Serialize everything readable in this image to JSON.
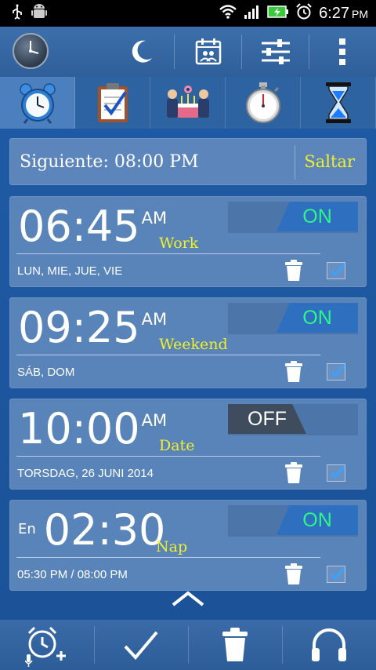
{
  "status_bar": {
    "time": "6:27",
    "ampm": "PM"
  },
  "icons": {
    "night_mode": "moon-icon",
    "calendar": "calendar-icon",
    "settings": "sliders-icon",
    "menu": "overflow-menu-icon"
  },
  "tabs": [
    {
      "name": "alarm-clock-icon",
      "active": true
    },
    {
      "name": "clipboard-icon",
      "active": false
    },
    {
      "name": "birthday-cake-icon",
      "active": false
    },
    {
      "name": "stopwatch-icon",
      "active": false
    },
    {
      "name": "hourglass-icon",
      "active": false
    }
  ],
  "next_alarm": {
    "label": "Siguiente:  08:00 PM",
    "skip_label": "Saltar"
  },
  "alarms": [
    {
      "prefix": "",
      "time": "06:45",
      "ampm": "AM",
      "label": "Work",
      "days": "LUN, MIE, JUE, VIE",
      "toggle": "ON",
      "enabled": true,
      "checked": true
    },
    {
      "prefix": "",
      "time": "09:25",
      "ampm": "AM",
      "label": "Weekend",
      "days": "SÁB, DOM",
      "toggle": "ON",
      "enabled": true,
      "checked": true
    },
    {
      "prefix": "",
      "time": "10:00",
      "ampm": "AM",
      "label": "Date",
      "days": "TORSDAG, 26 JUNI 2014",
      "toggle": "OFF",
      "enabled": false,
      "checked": true
    },
    {
      "prefix": "En",
      "time": "02:30",
      "ampm": "",
      "label": "Nap",
      "days": "05:30 PM / 08:00 PM",
      "toggle": "ON",
      "enabled": true,
      "checked": true
    }
  ],
  "colors": {
    "background": "#1f5aa1",
    "card": "#5884b9",
    "label_yellow": "#f2ef2a",
    "toggle_on_text": "#2ef78a",
    "toggle_off_bg": "#3f4c5e"
  }
}
